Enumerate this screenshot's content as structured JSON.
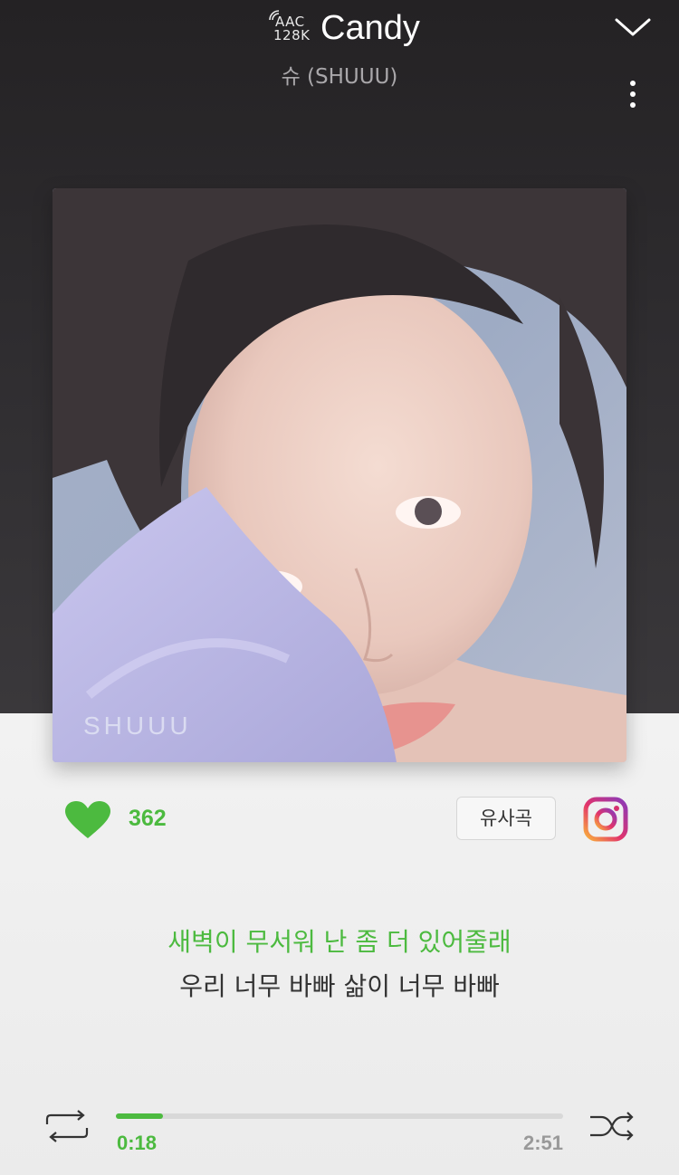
{
  "header": {
    "quality_line1": "AAC",
    "quality_line2": "128K",
    "title": "Candy",
    "artist": "슈 (SHUUU)"
  },
  "album": {
    "watermark": "SHUUU"
  },
  "actions": {
    "like_count": "362",
    "similar_label": "유사곡"
  },
  "lyrics": {
    "current": "새벽이 무서워 난 좀 더 있어줄래",
    "next": "우리 너무 바빠 삶이 너무 바빠"
  },
  "player": {
    "elapsed": "0:18",
    "total": "2:51",
    "progress_fraction": 0.105
  },
  "colors": {
    "accent": "#4cba3f",
    "header_bg": "#2a282b",
    "panel_bg": "#efefef"
  },
  "icons": [
    "chevron-down-icon",
    "more-vertical-icon",
    "heart-icon",
    "instagram-icon",
    "repeat-icon",
    "shuffle-icon"
  ]
}
